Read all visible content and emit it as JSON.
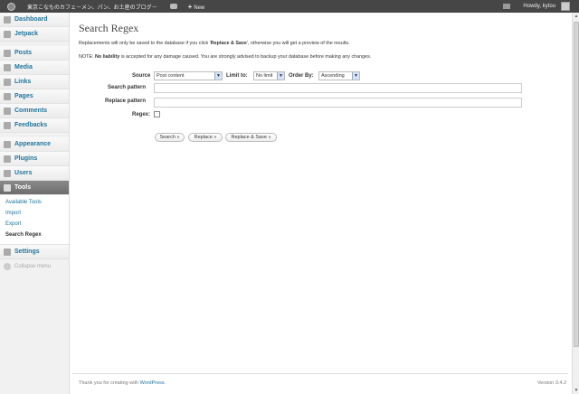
{
  "adminbar": {
    "site_name": "東京こなものカフェ－メン、パン、お土産のブログ－",
    "new_label": "New",
    "new_plus": "+",
    "howdy": "Howdy, kytou"
  },
  "sidebar": {
    "items": [
      {
        "label": "Dashboard",
        "icon": "dashboard-icon"
      },
      {
        "label": "Jetpack",
        "icon": "jetpack-icon"
      },
      {
        "label": "Posts",
        "icon": "pin-icon"
      },
      {
        "label": "Media",
        "icon": "media-icon"
      },
      {
        "label": "Links",
        "icon": "link-icon"
      },
      {
        "label": "Pages",
        "icon": "page-icon"
      },
      {
        "label": "Comments",
        "icon": "comment-icon"
      },
      {
        "label": "Feedbacks",
        "icon": "feedback-icon"
      },
      {
        "label": "Appearance",
        "icon": "appearance-icon"
      },
      {
        "label": "Plugins",
        "icon": "plugin-icon"
      },
      {
        "label": "Users",
        "icon": "users-icon"
      },
      {
        "label": "Tools",
        "icon": "tools-icon"
      },
      {
        "label": "Settings",
        "icon": "settings-icon"
      }
    ],
    "tools_sub": [
      "Available Tools",
      "Import",
      "Export",
      "Search Regex"
    ],
    "collapse": "Collapse menu"
  },
  "main": {
    "title": "Search Regex",
    "intro_pre": "Replacements will only be saved to the database if you click '",
    "intro_bold": "Replace & Save",
    "intro_post": "', otherwise you will get a preview of the results.",
    "note_pre": "NOTE: ",
    "note_bold": "No liability",
    "note_post": " is accepted for any damage caused. You are strongly advised to backup your database before making any changes.",
    "source_label": "Source",
    "source_value": "Post content",
    "limit_label": "Limit to:",
    "limit_value": "No limit",
    "order_label": "Order By:",
    "order_value": "Ascending",
    "search_pattern_label": "Search pattern",
    "replace_pattern_label": "Replace pattern",
    "regex_label": "Regex:",
    "search_btn": "Search »",
    "replace_btn": "Replace »",
    "replace_save_btn": "Replace & Save »"
  },
  "footer": {
    "thanks_pre": "Thank you for creating with ",
    "thanks_link": "WordPress",
    "thanks_post": ".",
    "version": "Version 3.4.2"
  }
}
